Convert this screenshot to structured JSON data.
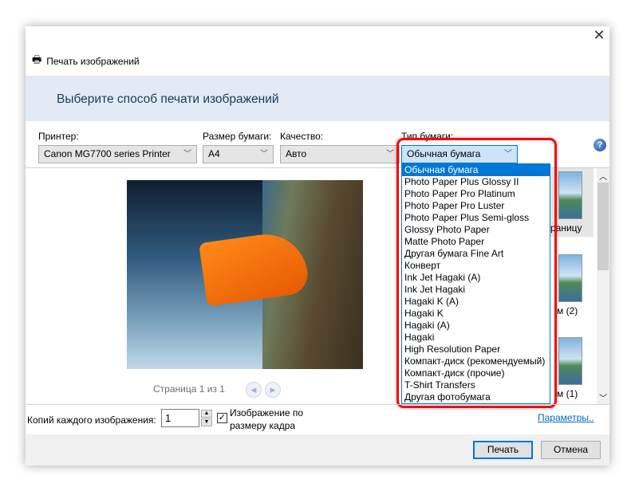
{
  "window": {
    "title": "Печать изображений",
    "close": "✕"
  },
  "header": {
    "heading": "Выберите способ печати изображений"
  },
  "printer": {
    "label": "Принтер:",
    "value": "Canon MG7700 series Printer"
  },
  "paper_size": {
    "label": "Размер бумаги:",
    "value": "A4"
  },
  "quality": {
    "label": "Качество:",
    "value": "Авто"
  },
  "paper_type": {
    "label": "Тип бумаги:",
    "value": "Обычная бумага",
    "options": [
      "Обычная бумага",
      "Photo Paper Plus Glossy II",
      "Photo Paper Pro Platinum",
      "Photo Paper Pro Luster",
      "Photo Paper Plus Semi-gloss",
      "Glossy Photo Paper",
      "Matte Photo Paper",
      "Другая бумага Fine Art",
      "Конверт",
      "Ink Jet Hagaki (A)",
      "Ink Jet Hagaki",
      "Hagaki K (A)",
      "Hagaki K",
      "Hagaki (A)",
      "Hagaki",
      "High Resolution Paper",
      "Компакт-диск (рекомендуемый)",
      "Компакт-диск (прочие)",
      "T-Shirt Transfers",
      "Другая фотобумага"
    ],
    "highlight_color": "#ff0000"
  },
  "preview": {
    "page_text": "Страница 1 из 1"
  },
  "layouts": [
    {
      "label": "раницу"
    },
    {
      "label": "м (2)"
    },
    {
      "label": "м (1)"
    }
  ],
  "copies": {
    "label": "Копий каждого изображения:",
    "value": "1"
  },
  "fit": {
    "label1": "Изображение по",
    "label2": "размеру кадра",
    "checked": true
  },
  "options_link": "Параметры..",
  "buttons": {
    "print": "Печать",
    "cancel": "Отмена"
  }
}
